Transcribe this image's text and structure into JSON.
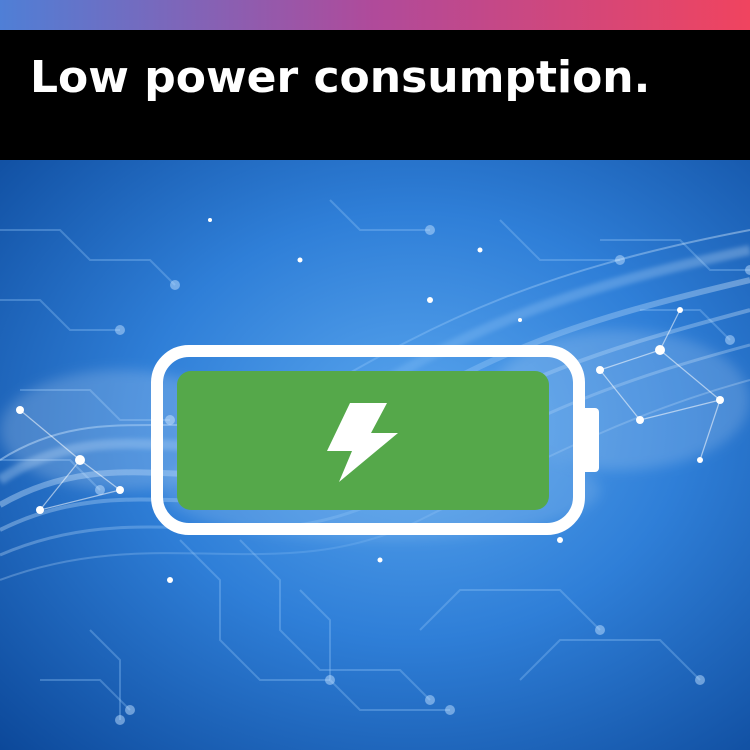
{
  "header": {
    "title": "Low power consumption."
  },
  "colors": {
    "accent_start": "#4f7fd6",
    "accent_mid": "#b04a9a",
    "accent_end": "#f0445f",
    "band": "#000000",
    "title_text": "#ffffff",
    "background_deep": "#0b4aa0",
    "background_light": "#3f8fe0",
    "battery_outline": "#ffffff",
    "battery_fill": "#55a84a",
    "bolt": "#ffffff"
  },
  "battery": {
    "charge_fraction": 1.0,
    "icon": "lightning-bolt-icon"
  }
}
